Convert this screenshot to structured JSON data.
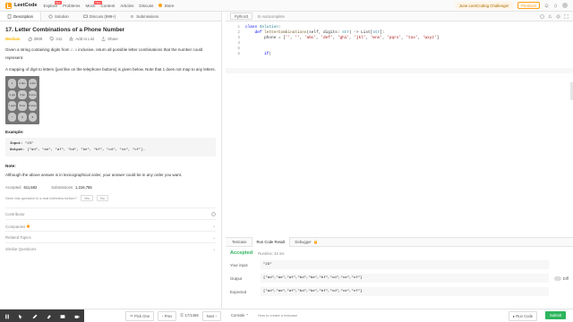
{
  "nav": {
    "logo": "LeetCode",
    "links": [
      "Explore",
      "Problems",
      "Mock",
      "Contest",
      "Articles",
      "Discuss",
      "Store"
    ],
    "new_badge": "New",
    "challenge": "June LeetCoding Challenge!",
    "premium": "Premium",
    "accent": "#ffa116"
  },
  "tabs": [
    {
      "label": "Description",
      "icon": "description-icon"
    },
    {
      "label": "Solution",
      "icon": "solution-icon"
    },
    {
      "label": "Discuss (999+)",
      "icon": "discuss-icon"
    },
    {
      "label": "Submissions",
      "icon": "submissions-icon"
    }
  ],
  "problem": {
    "title": "17. Letter Combinations of a Phone Number",
    "difficulty": "Medium",
    "likes": "3909",
    "dislikes": "411",
    "add_to_list": "Add to List",
    "share": "Share",
    "para1a": "Given a string containing digits from",
    "para1_code": "2-9",
    "para1b": "inclusive, return all possible letter combinations that the number could represent.",
    "para2": "A mapping of digit to letters (just like on the telephone buttons) is given below. Note that 1 does not map to any letters.",
    "keys": [
      "1",
      "2 abc",
      "3 def",
      "4 ghi",
      "5 jkl",
      "6 mno",
      "7 pqrs",
      "8 tuv",
      "9 wxyz",
      "*",
      "0",
      "#"
    ],
    "example_heading": "Example:",
    "example_input_label": "Input:",
    "example_input": "\"23\"",
    "example_output_label": "Output:",
    "example_output": "[\"ad\", \"ae\", \"af\", \"bd\", \"be\", \"bf\", \"cd\", \"ce\", \"cf\"].",
    "note_heading": "Note:",
    "note": "Although the above answer is in lexicographical order, your answer could be in any order you want.",
    "accepted_label": "Accepted",
    "accepted_value": "611,682",
    "submissions_label": "Submissions",
    "submissions_value": "1,316,755",
    "seen_question": "Seen this question in a real interview before?",
    "yes": "Yes",
    "no": "No",
    "sections": [
      "Contributor",
      "Companies",
      "Related Topics",
      "Similar Questions"
    ]
  },
  "editor": {
    "language": "Python3",
    "autocomplete": "Autocomplete",
    "line_numbers": [
      "1",
      "2",
      "3",
      "4",
      "5",
      "6"
    ]
  },
  "console": {
    "tabs": [
      "Testcase",
      "Run Code Result",
      "Debugger"
    ],
    "status": "Accepted",
    "runtime": "Runtime: 44 ms",
    "input_label": "Your input",
    "input_value": "\"23\"",
    "output_label": "Output",
    "output_value": "[\"ad\",\"ae\",\"af\",\"bd\",\"be\",\"bf\",\"cd\",\"ce\",\"cf\"]",
    "expected_label": "Expected",
    "expected_value": "[\"ad\",\"ae\",\"af\",\"bd\",\"be\",\"bf\",\"cd\",\"ce\",\"cf\"]",
    "diff_label": "Diff",
    "accent": "#2db55d"
  },
  "footer": {
    "pick_one": "Pick One",
    "prev": "Prev",
    "count": "17/1468",
    "next": "Next",
    "console": "Console",
    "create_testcase": "How to create a testcase",
    "run_code": "Run Code",
    "submit": "Submit"
  }
}
